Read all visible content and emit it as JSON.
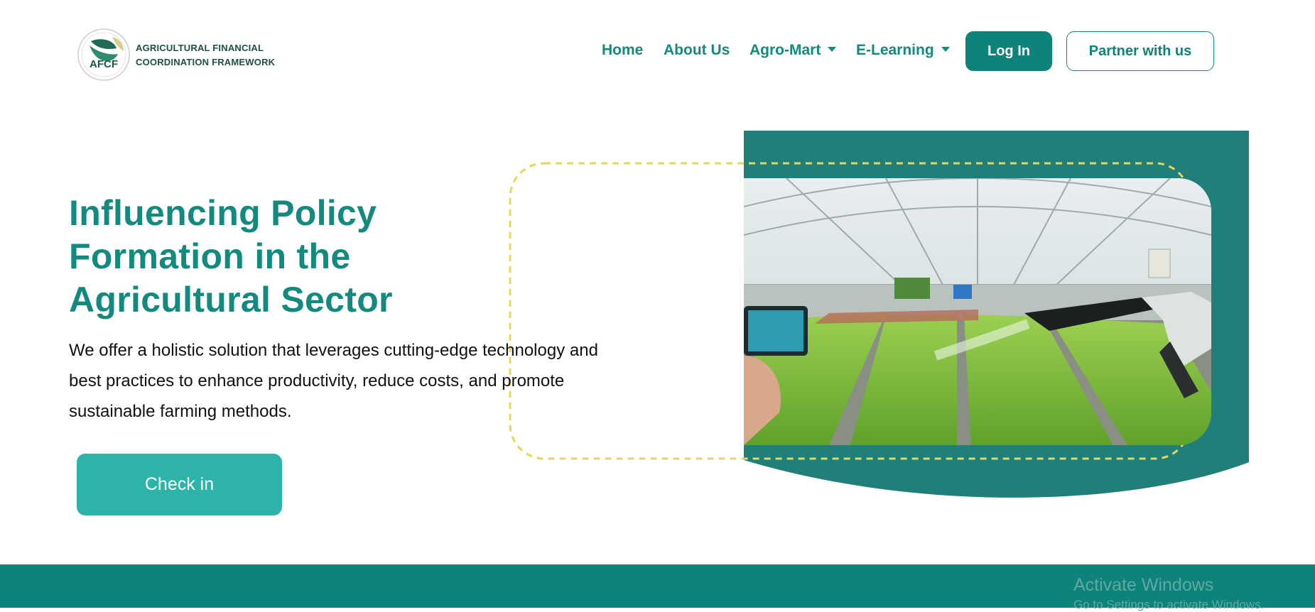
{
  "header": {
    "logo_text": "AFCF",
    "brand_line1": "AGRICULTURAL FINANCIAL",
    "brand_line2": "COORDINATION FRAMEWORK",
    "nav": [
      {
        "label": "Home"
      },
      {
        "label": "About Us"
      },
      {
        "label": "Agro-Mart"
      },
      {
        "label": "E-Learning"
      }
    ],
    "login_label": "Log In",
    "partner_label": "Partner with us"
  },
  "hero": {
    "title_line1": "Influencing Policy",
    "title_line2": "Formation in the",
    "title_line3": "Agricultural Sector",
    "desc_line1": "We offer a holistic solution that leverages cutting-edge technology and",
    "desc_line2": "best practices to enhance productivity, reduce costs, and promote",
    "desc_line3": "sustainable farming methods.",
    "cta_label": "Check in"
  },
  "watermark": {
    "title": "Activate Windows",
    "subtitle": "Go to Settings to activate Windows."
  },
  "colors": {
    "primary": "#0e8379",
    "teal_panel": "#217f79",
    "cta": "#2db3a9",
    "dash": "#e6d75a"
  }
}
